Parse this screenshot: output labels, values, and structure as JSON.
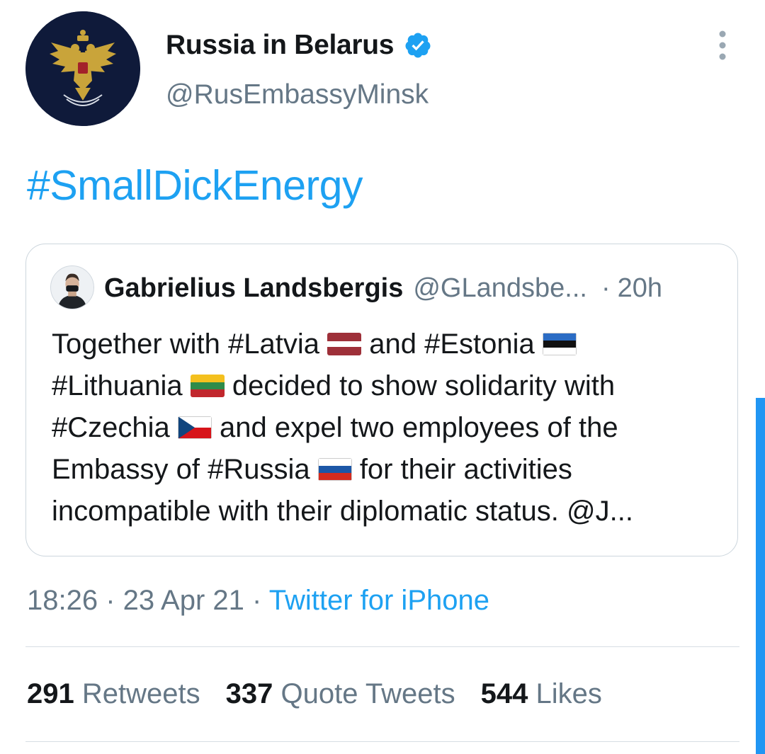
{
  "account": {
    "name": "Russia in Belarus",
    "handle": "@RusEmbassyMinsk",
    "verified": true
  },
  "tweet": {
    "text": "#SmallDickEnergy"
  },
  "quoted_tweet": {
    "author_name": "Gabrielius Landsbergis",
    "author_handle": "@GLandsbe...",
    "separator": "·",
    "time_ago": "20h",
    "lines": [
      {
        "before": "Together with #Latvia ",
        "flag": "latvia-flag",
        "after": " and #Estonia ",
        "flag2": "estonia-flag"
      },
      {
        "before": "#Lithuania ",
        "flag": "lithuania-flag",
        "after": " decided to show solidarity with"
      },
      {
        "before": "#Czechia ",
        "flag": "czechia-flag",
        "after": " and expel two employees of the"
      },
      {
        "before": "Embassy of #Russia ",
        "flag": "russia-flag",
        "after": " for their activities"
      },
      {
        "before": "incompatible with their diplomatic status. @J..."
      }
    ]
  },
  "meta": {
    "time": "18:26",
    "sep1": " · ",
    "date": "23 Apr 21",
    "sep2": " · ",
    "source": "Twitter for iPhone"
  },
  "stats": {
    "retweets_count": "291",
    "retweets_label": "Retweets",
    "quotes_count": "337",
    "quotes_label": "Quote Tweets",
    "likes_count": "544",
    "likes_label": "Likes"
  },
  "colors": {
    "link": "#1da1f2",
    "secondary_text": "#657786",
    "avatar_bg": "#0f1a3a",
    "emblem_gold": "#c9a43a",
    "scrollbar": "#2196f3"
  }
}
